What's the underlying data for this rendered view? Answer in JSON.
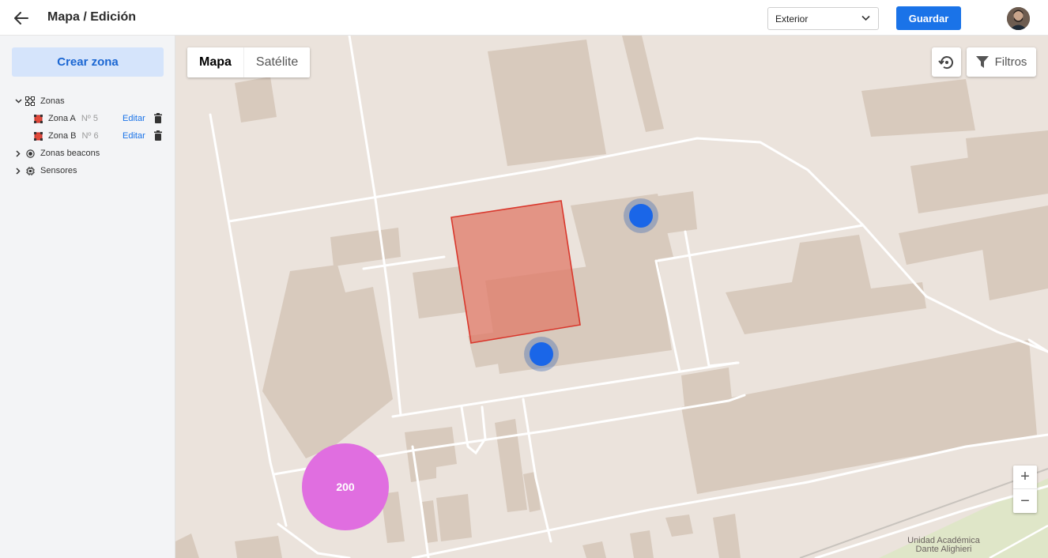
{
  "header": {
    "title": "Mapa / Edición",
    "location_select": "Exterior",
    "save_label": "Guardar"
  },
  "sidebar": {
    "create_zone_label": "Crear zona",
    "tree": {
      "zones_label": "Zonas",
      "zones": [
        {
          "name": "Zona A",
          "number": "Nº 5",
          "edit_label": "Editar"
        },
        {
          "name": "Zona B",
          "number": "Nº 6",
          "edit_label": "Editar"
        }
      ],
      "beacon_zones_label": "Zonas beacons",
      "sensors_label": "Sensores"
    }
  },
  "map": {
    "type_map_label": "Mapa",
    "type_satellite_label": "Satélite",
    "filters_label": "Filtros",
    "zoom_in": "+",
    "zoom_out": "−",
    "cluster_count": "200",
    "place_label_line1": "Unidad Académica",
    "place_label_line2": "Dante Alighieri"
  },
  "colors": {
    "accent": "#1a73e8",
    "zone_fill": "#e07a68",
    "cluster": "#e06ee0",
    "map_bg": "#ebe3dc",
    "building": "#d8cabd"
  }
}
